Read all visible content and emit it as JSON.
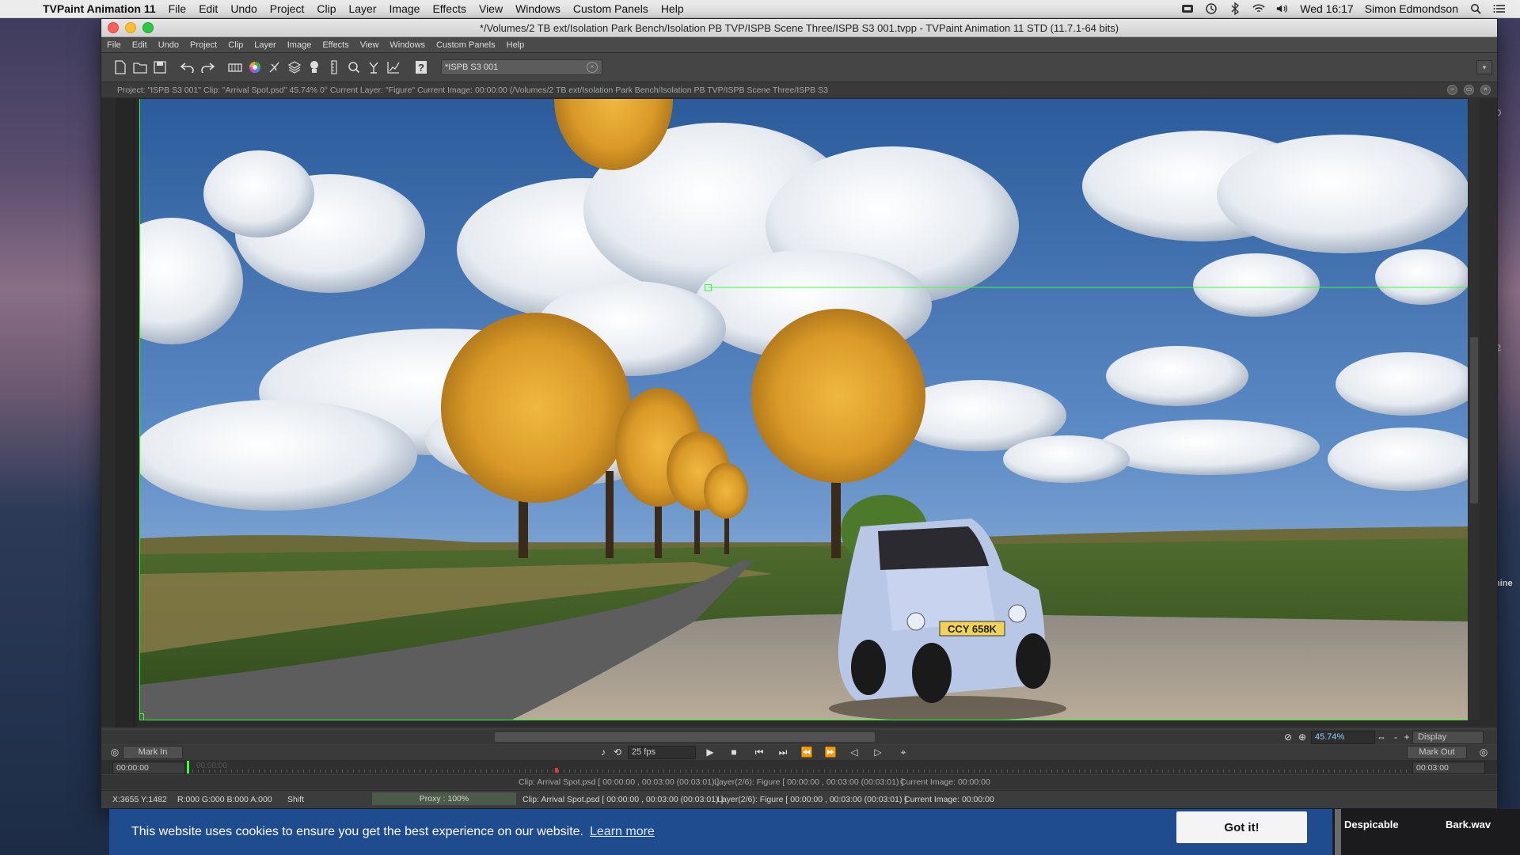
{
  "mac_menubar": {
    "app_name": "TVPaint Animation 11",
    "menus": [
      "File",
      "Edit",
      "Undo",
      "Project",
      "Clip",
      "Layer",
      "Image",
      "Effects",
      "View",
      "Windows",
      "Custom Panels",
      "Help"
    ],
    "clock": "Wed 16:17",
    "user": "Simon Edmondson",
    "status_icons": [
      "dropbox-icon",
      "time-machine-icon",
      "bluetooth-icon",
      "wifi-icon",
      "volume-icon",
      "search-icon",
      "notification-center-icon"
    ]
  },
  "window": {
    "title": "*/Volumes/2 TB ext/Isolation Park Bench/Isolation PB TVP/ISPB Scene Three/ISPB S3 001.tvpp - TVPaint Animation 11 STD (11.7.1-64 bits)",
    "app_menu": [
      "File",
      "Edit",
      "Undo",
      "Project",
      "Clip",
      "Layer",
      "Image",
      "Effects",
      "View",
      "Windows",
      "Custom Panels",
      "Help"
    ],
    "project_field": "*ISPB S3 001",
    "info_bar": "Project: \"ISPB S3 001\"   Clip: \"Arrival Spot.psd\"   45.74%   0°   Current Layer: \"Figure\"   Current Image: 00:00:00 (/Volumes/2 TB ext/Isolation Park Bench/Isolation PB TVP/ISPB Scene Three/ISPB S3",
    "car_plate": "CCY 658K"
  },
  "playback": {
    "zoom": "45.74%",
    "display_label": "Display",
    "fps": "25 fps",
    "mark_in": "Mark In",
    "mark_out": "Mark Out",
    "zoom_minus": "-",
    "zoom_plus": "+"
  },
  "timeline": {
    "start_tc": "00:00:00",
    "end_tc": "00:03:00",
    "cursor_ghost": "00:00:00"
  },
  "status": {
    "line_a": {
      "clip": "Clip: Arrival Spot.psd [ 00:00:00 , 00:03:00  (00:03:01) ]",
      "layer": "Layer(2/6): Figure [ 00:00:00 , 00:03:00  (00:03:01) ]",
      "image": "Current Image: 00:00:00"
    },
    "line_b": {
      "coords": "X:3655  Y:1482",
      "rgba": "R:000 G:000 B:000 A:000",
      "modifier": "Shift",
      "proxy": "Proxy : 100%",
      "clip": "Clip: Arrival Spot.psd [ 00:00:00 , 00:03:00  (00:03:01) ]",
      "layer": "Layer(2/6): Figure [ 00:00:00 , 00:03:00  (00:03:01) ]",
      "image": "Current Image: 00:00:00"
    }
  },
  "cookie_banner": {
    "message": "This website uses cookies to ensure you get the best experience on our website.",
    "learn_more": "Learn more",
    "button": "Got it!"
  },
  "background_window": {
    "item1": "Despicable",
    "item2": "Bark.wav"
  },
  "edge_fragments": [
    "0",
    "2",
    "nine"
  ],
  "colors": {
    "guide_green": "#39ff39",
    "cookie_blue": "#1f4c8f",
    "app_dark": "#3d3d3d"
  }
}
